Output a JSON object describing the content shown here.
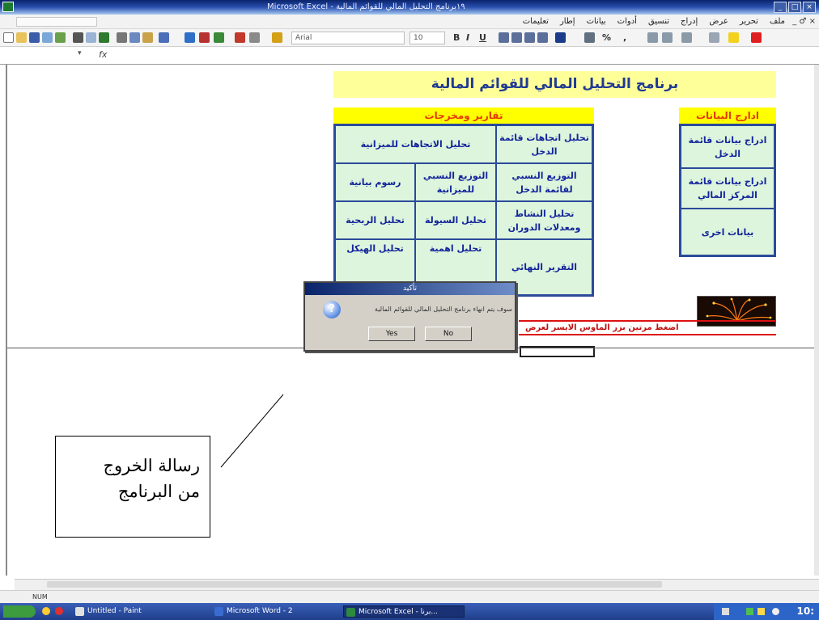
{
  "window": {
    "title": "Microsoft Excel - ١٩برنامج التحليل المالي للقوائم المالية",
    "name_box": "",
    "controls": [
      "_",
      "□",
      "×"
    ]
  },
  "menu": {
    "items": [
      "ملف",
      "تحرير",
      "عرض",
      "إدراج",
      "تنسيق",
      "أدوات",
      "بيانات",
      "إطار",
      "تعليمات"
    ],
    "doc_controls": "_ ♂ ×"
  },
  "toolbar": {
    "font_name": "Arial",
    "font_size": "10",
    "bold": "B",
    "italic": "I",
    "underline": "U",
    "percent": "%",
    "comma": ","
  },
  "formula_bar": {
    "fx": "fx",
    "dropdown": "▾"
  },
  "sheet": {
    "banner_title": "برنامج  التحليل المالي للقوائم المالية",
    "reports_header": "تقارير ومخرجات",
    "input_header": "ادارج البيانات",
    "reports": [
      "تحليل اتجاهات قائمة الدخل",
      "تحليل الاتجاهات للميزانية",
      "التوزيع النسبي لقائمة الدخل",
      "التوزيع النسبي للميزانية",
      "رسوم بيانية",
      "تحليل النشاط ومعدلات الدوران",
      "تحليل السيولة",
      "تحليل الربحية",
      "التقرير النهائي",
      "تحليل اهمية",
      "تحليل الهيكل"
    ],
    "inputs": [
      "ادراج بيانات قائمة الدخل",
      "ادراج بيانات قائمة المركز المالي",
      "بيانات اخرى"
    ],
    "hint": "اضغط مرتين بزر الماوس الايسر لعرض"
  },
  "dialog": {
    "title": "تأكيد",
    "message": "سوف يتم انهاء برنامج التحليل المالي للقوائم المالية",
    "yes": "Yes",
    "no": "No",
    "icon": "question-icon"
  },
  "annotation": {
    "line1": "رسالة الخروج",
    "line2": "من البرنامج"
  },
  "status": {
    "mode": "NUM"
  },
  "taskbar": {
    "tasks": [
      "Untitled - Paint",
      "Microsoft Word - 2",
      "Microsoft Excel - برنا..."
    ],
    "clock": "10:"
  }
}
